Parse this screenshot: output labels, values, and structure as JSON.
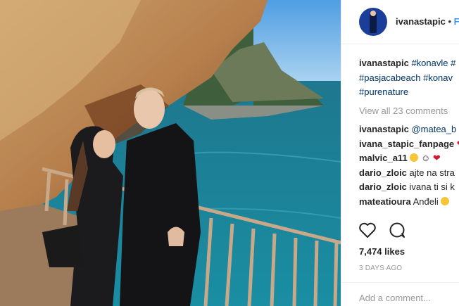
{
  "post": {
    "username": "ivanastapic",
    "separator": "•",
    "follow_label": "F"
  },
  "caption": {
    "username": "ivanastapic",
    "tag1": "#konavle",
    "tag1_extra": "#",
    "tag2": "#pasjacabeach",
    "tag3": "#konav",
    "tag4": "#purenature"
  },
  "view_all_label": "View all 23 comments",
  "comments": [
    {
      "user": "ivanastapic",
      "text": "@matea_b"
    },
    {
      "user": "ivana_stapic_fanpage",
      "text": "❤"
    },
    {
      "user": "malvic_a11",
      "text": "☺"
    },
    {
      "user": "dario_zloic",
      "text": "ajte na stra"
    },
    {
      "user": "dario_zloic",
      "text": "ivana ti si k"
    },
    {
      "user": "mateatioura",
      "text": "Anđeli"
    }
  ],
  "likes_label": "7,474 likes",
  "time_label": "3 DAYS AGO",
  "add_comment_placeholder": "Add a comment...",
  "icons": {
    "like": "heart-outline-icon",
    "comment": "comment-bubble-icon",
    "avatar": "profile-avatar"
  },
  "colors": {
    "link": "#003569",
    "follow": "#3897f0",
    "muted": "#999999",
    "text": "#262626"
  }
}
